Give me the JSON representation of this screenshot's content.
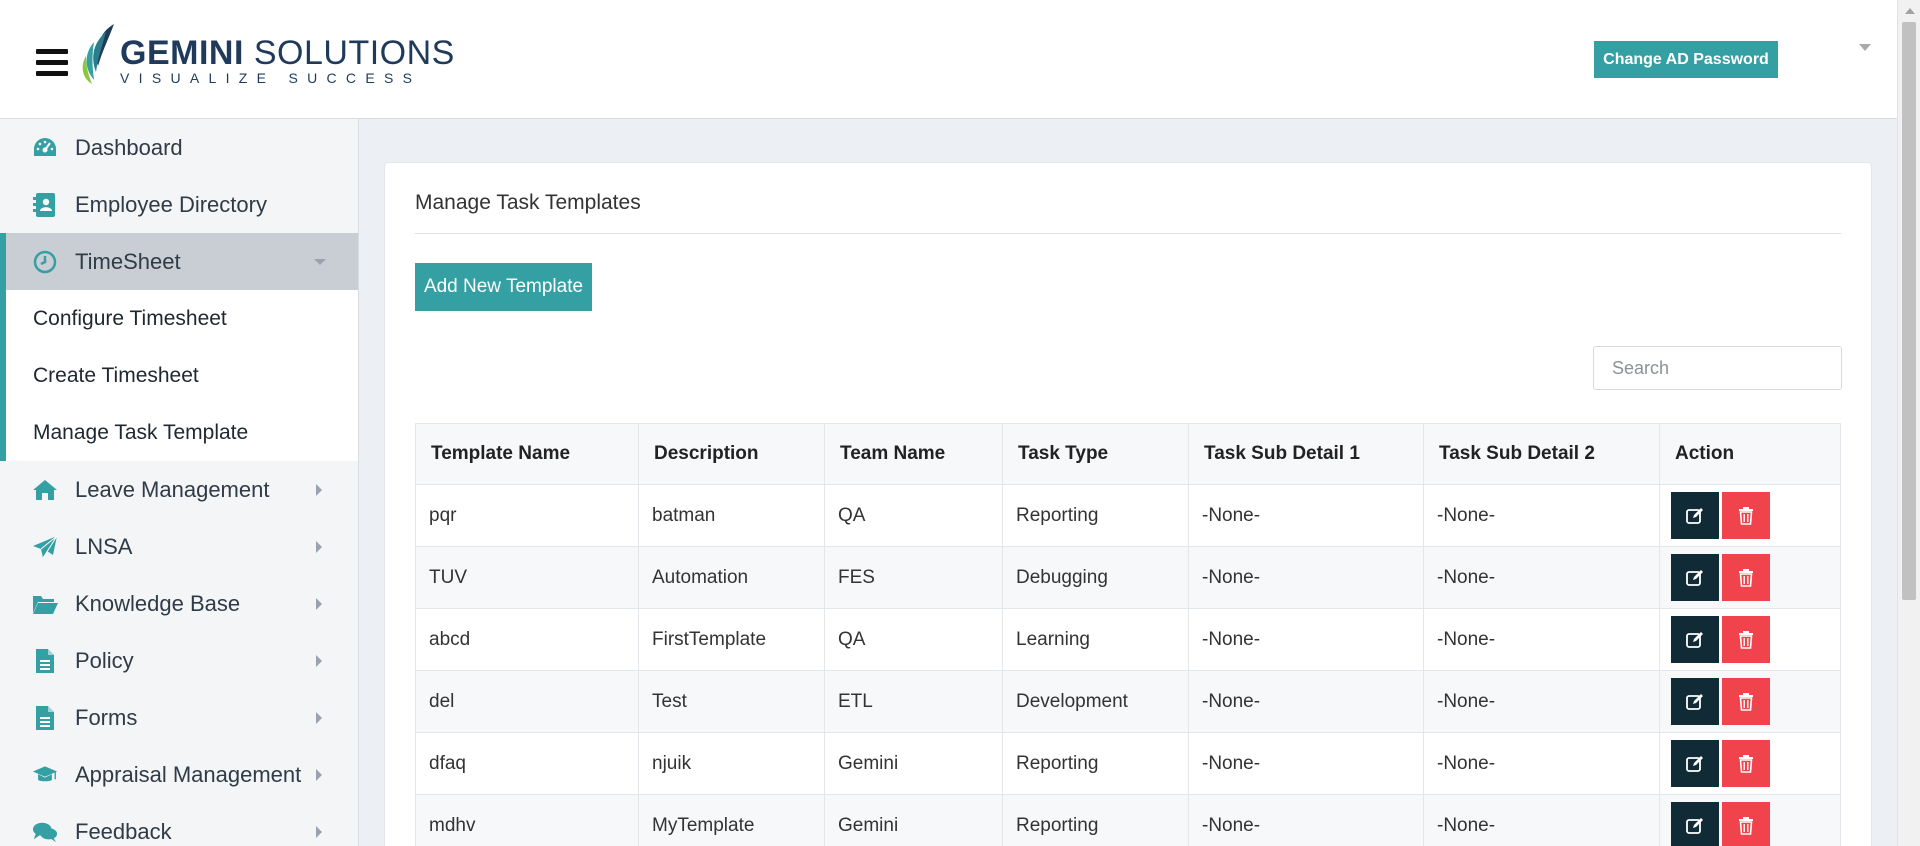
{
  "header": {
    "logo": {
      "word1": "GEMINI",
      "word2": " SOLUTIONS",
      "tagline": "VISUALIZE SUCCESS"
    },
    "change_password_label": "Change AD Password",
    "accent_color": "#35a0a3"
  },
  "sidebar": {
    "items": [
      {
        "label": "Dashboard",
        "icon": "dashboard-gauge-icon"
      },
      {
        "label": "Employee Directory",
        "icon": "address-book-icon"
      },
      {
        "label": "TimeSheet",
        "icon": "clock-icon",
        "active": true
      },
      {
        "label": "Leave Management",
        "icon": "home-icon"
      },
      {
        "label": "LNSA",
        "icon": "paper-plane-icon"
      },
      {
        "label": "Knowledge Base",
        "icon": "folder-open-icon"
      },
      {
        "label": "Policy",
        "icon": "document-icon"
      },
      {
        "label": "Forms",
        "icon": "document-icon"
      },
      {
        "label": "Appraisal Management",
        "icon": "graduation-cap-icon"
      },
      {
        "label": "Feedback",
        "icon": "comments-icon"
      }
    ],
    "timesheet_submenu": [
      {
        "label": "Configure Timesheet"
      },
      {
        "label": "Create Timesheet"
      },
      {
        "label": "Manage Task Template"
      }
    ]
  },
  "main": {
    "title": "Manage Task Templates",
    "add_button_label": "Add New Template",
    "search_placeholder": "Search",
    "table": {
      "columns": [
        "Template Name",
        "Description",
        "Team Name",
        "Task Type",
        "Task Sub Detail 1",
        "Task Sub Detail 2",
        "Action"
      ],
      "rows": [
        [
          "pqr",
          "batman",
          "QA",
          "Reporting",
          "-None-",
          "-None-"
        ],
        [
          "TUV",
          "Automation",
          "FES",
          "Debugging",
          "-None-",
          "-None-"
        ],
        [
          "abcd",
          "FirstTemplate",
          "QA",
          "Learning",
          "-None-",
          "-None-"
        ],
        [
          "del",
          "Test",
          "ETL",
          "Development",
          "-None-",
          "-None-"
        ],
        [
          "dfaq",
          "njuik",
          "Gemini",
          "Reporting",
          "-None-",
          "-None-"
        ],
        [
          "mdhv",
          "MyTemplate",
          "Gemini",
          "Reporting",
          "-None-",
          "-None-"
        ]
      ]
    }
  }
}
